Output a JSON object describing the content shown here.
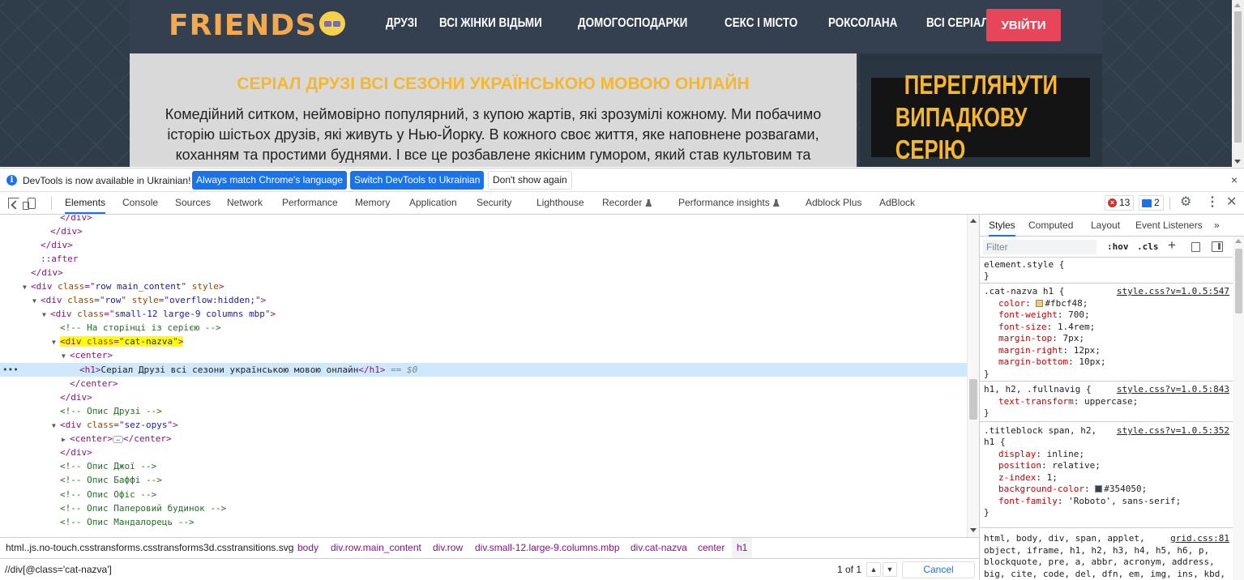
{
  "site": {
    "logo_text": "FRIENDS",
    "nav_items": [
      "ДРУЗІ",
      "ВСІ ЖІНКИ ВІДЬМИ",
      "ДОМОГОСПОДАРКИ",
      "СЕКС І МІСТО",
      "РОКСОЛАНА",
      "ВСІ СЕРІАЛИ"
    ],
    "login_label": "УВІЙТИ",
    "title": "СЕРІАЛ ДРУЗІ ВСІ СЕЗОНИ УКРАЇНСЬКОЮ МОВОЮ ОНЛАЙН",
    "description": "Комедійний ситком, неймовірно популярний, з купою жартів, які зрозумілі кожному. Ми побачимо історію шістьох друзів, які живуть у Нью-Йорку. В кожного своє життя, яке наповнене розвагами, коханням та простими буднями. І все це розбавлене якісним гумором, який став культовим та актуальним і в наші часи.",
    "random_banner_line1": "ПЕРЕГЛЯНУТИ",
    "random_banner_line2": "ВИПАДКОВУ СЕРІЮ",
    "colors": {
      "accent": "#f6b72f",
      "login": "#e6455a",
      "header_bg": "#344050"
    }
  },
  "infobar": {
    "message": "DevTools is now available in Ukrainian!",
    "match_button": "Always match Chrome's language",
    "switch_button": "Switch DevTools to Ukrainian",
    "dismiss_button": "Don't show again",
    "close_symbol": "×"
  },
  "toolbar": {
    "tabs": [
      "Elements",
      "Console",
      "Sources",
      "Network",
      "Performance",
      "Memory",
      "Application",
      "Security",
      "Lighthouse",
      "Recorder",
      "Performance insights",
      "Adblock Plus",
      "AdBlock"
    ],
    "active_tab": "Elements",
    "error_count": "13",
    "message_count": "2"
  },
  "dom_tree": {
    "close_div": "</div>",
    "after_pseudo": "::after",
    "main_content_class": "row main_content",
    "main_content_style": "style",
    "row_class": "row",
    "row_style": "overflow:hidden;",
    "columns_class": "small-12 large-9 columns mbp",
    "comment_series_page": "<!-- На сторінці із серією -->",
    "cat_nazva_class": "cat-nazva",
    "h1_text": "Серіал Друзі всі сезони українською мовою онлайн",
    "selected_marker": "== $0",
    "comment_opys_druzi": "<!-- Опис Друзі -->",
    "sez_opys_class": "sez-opys",
    "comment_joey": "<!-- Опис Джої -->",
    "comment_buffy": "<!-- Опис Баффі -->",
    "comment_office": "<!-- Опис Офіс -->",
    "comment_paper_house": "<!-- Опис Паперовий будинок -->",
    "comment_mandalorian": "<!-- Опис Мандалорець -->"
  },
  "breadcrumbs": [
    "html..js.no-touch.csstransforms.csstransforms3d.csstransitions.svg",
    "body",
    "div.row.main_content",
    "div.row",
    "div.small-12.large-9.columns.mbp",
    "div.cat-nazva",
    "center",
    "h1"
  ],
  "search": {
    "query": "//div[@class='cat-nazva']",
    "result": "1 of 1",
    "cancel_label": "Cancel"
  },
  "styles_pane": {
    "tabs": [
      "Styles",
      "Computed",
      "Layout",
      "Event Listeners",
      "»"
    ],
    "active_tab": "Styles",
    "filter_placeholder": "Filter",
    "hov_label": ":hov",
    "cls_label": ".cls",
    "rules": [
      {
        "selector": "element.style {",
        "source": "",
        "props": []
      },
      {
        "selector": ".cat-nazva h1 {",
        "source": "style.css?v=1.0.5:547",
        "props": [
          [
            "color",
            "#fbcf48"
          ],
          [
            "font-weight",
            "700"
          ],
          [
            "font-size",
            "1.4rem"
          ],
          [
            "margin-top",
            "7px"
          ],
          [
            "margin-right",
            "12px"
          ],
          [
            "margin-bottom",
            "10px"
          ]
        ]
      },
      {
        "selector": "h1, h2, .fullnavig {",
        "source": "style.css?v=1.0.5:843",
        "props": [
          [
            "text-transform",
            "uppercase"
          ]
        ]
      },
      {
        "selector": ".titleblock span, h2,",
        "selector2": "h1 {",
        "source": "style.css?v=1.0.5:352",
        "props": [
          [
            "display",
            "inline"
          ],
          [
            "position",
            "relative"
          ],
          [
            "z-index",
            "1"
          ],
          [
            "background-color",
            "#354050"
          ],
          [
            "font-family",
            "'Roboto', sans-serif"
          ]
        ]
      },
      {
        "selector": "html, body, div, span, applet,",
        "source": "grid.css:81",
        "lines": [
          "object, iframe, h1, h2, h3, h4, h5, h6, p,",
          "blockquote, pre, a, abbr, acronym, address,",
          "big, cite, code, del, dfn, em, img, ins, kbd,"
        ]
      }
    ]
  }
}
